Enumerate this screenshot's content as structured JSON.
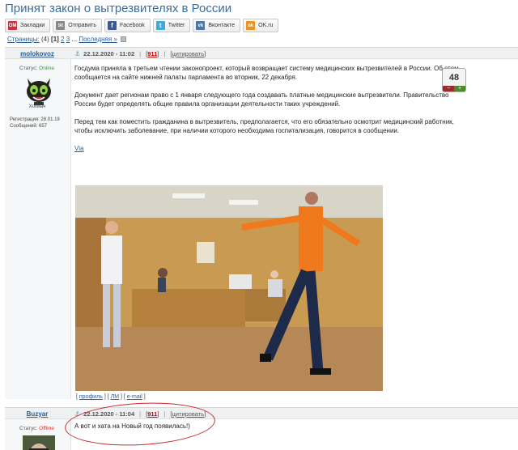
{
  "page": {
    "title": "Принят закон о вытрезвителях в России"
  },
  "share": [
    {
      "label": "Закладки",
      "icon": "bookmarks-icon",
      "color": "#c8323c",
      "glyph": "OM"
    },
    {
      "label": "Отправить",
      "icon": "mail-icon",
      "color": "#888888",
      "glyph": "✉"
    },
    {
      "label": "Facebook",
      "icon": "facebook-icon",
      "color": "#3b5998",
      "glyph": "f"
    },
    {
      "label": "Twitter",
      "icon": "twitter-icon",
      "color": "#3fa9e0",
      "glyph": "t"
    },
    {
      "label": "Вконтакте",
      "icon": "vk-icon",
      "color": "#4a76a8",
      "glyph": "vk"
    },
    {
      "label": "OK.ru",
      "icon": "ok-icon",
      "color": "#f2901e",
      "glyph": "ok"
    }
  ],
  "pagination": {
    "label": "Страницы:",
    "count": "(4)",
    "current": "[1]",
    "p2": "2",
    "p3": "3",
    "dots": "...",
    "last": "Последняя »"
  },
  "post1": {
    "author": "molokovoz",
    "status_label": "Статус:",
    "status": "Online",
    "rank": "Хохмач",
    "registration": "Регистрация: 28.01.19",
    "messages": "Сообщений: 657",
    "date": "22.12.2020 - 11:02",
    "number": "911",
    "cite": "цитировать",
    "rating": "48",
    "paragraphs": [
      "Госдума приняла в третьем чтении законопроект, который возвращает систему медицинских вытрезвителей в России. Об этом сообщается на сайте нижней палаты парламента во вторник, 22 декабря.",
      "Документ дает регионам право с 1 января следующего года создавать платные медицинские вытрезвители. Правительство России будет определять общие правила организации деятельности таких учреждений.",
      "Перед тем как поместить гражданина в вытрезвитель, предполагается, что его обязательно осмотрит медицинский работник, чтобы исключить заболевание, при наличии которого необходима госпитализация, говорится в сообщении."
    ],
    "via": "Via",
    "links": {
      "profile": "профиль",
      "pm": "ЛМ",
      "email": "e-mail"
    }
  },
  "post2": {
    "author": "Buzyar",
    "status_label": "Статус:",
    "status": "Offline",
    "date": "22.12.2020 - 11:04",
    "number": "911",
    "cite": "цитировать",
    "text": "А вот и хата на Новый год появилась!)"
  }
}
